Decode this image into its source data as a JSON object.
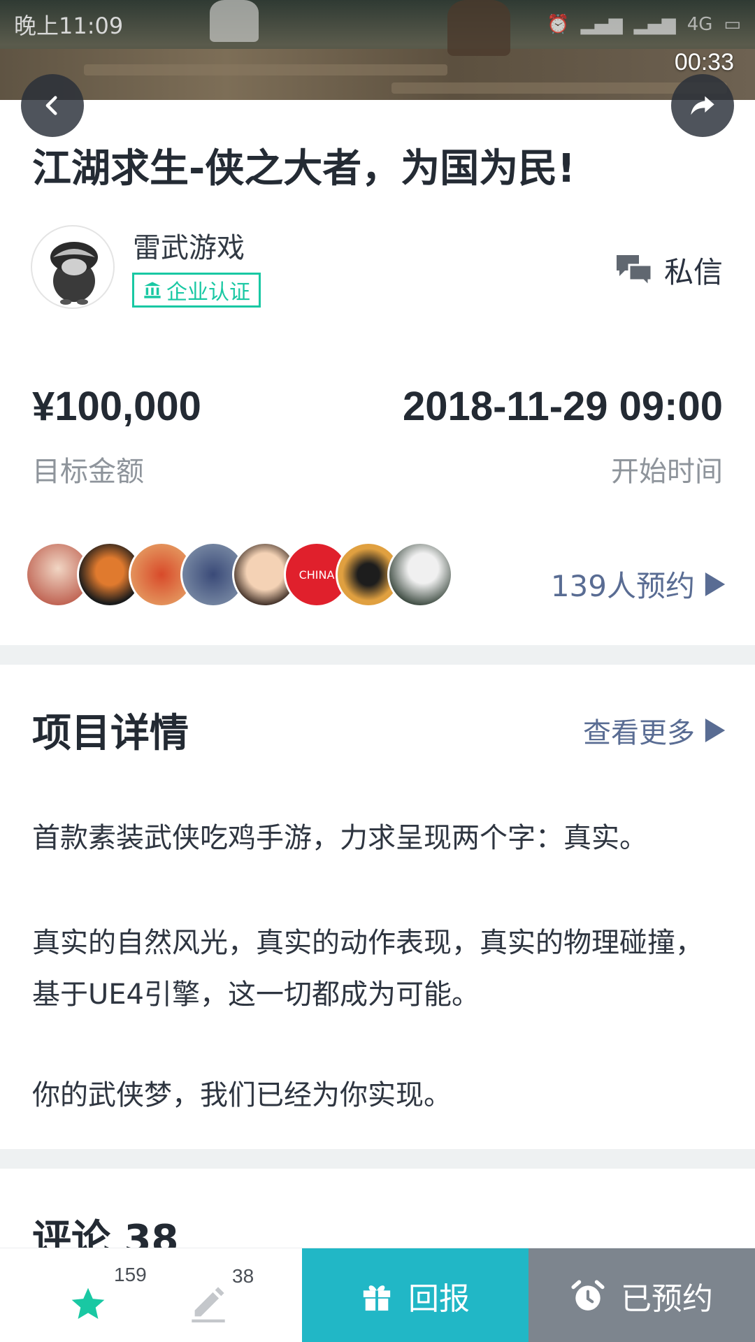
{
  "status_bar": {
    "time": "晚上11:09",
    "network": "4G"
  },
  "video": {
    "time": "00:33"
  },
  "project": {
    "title": "江湖求生-侠之大者，为国为民!",
    "author": "雷武游戏",
    "verified_label": "企业认证",
    "dm_label": "私信",
    "amount": "¥100,000",
    "amount_label": "目标金额",
    "start_time": "2018-11-29 09:00",
    "start_label": "开始时间",
    "reserve_count": "139人预约",
    "supporter_badge": "CHINA"
  },
  "details": {
    "title": "项目详情",
    "see_more": "查看更多",
    "paragraphs": [
      "首款素装武侠吃鸡手游，力求呈现两个字：真实。",
      "真实的自然风光，真实的动作表现，真实的物理碰撞，基于UE4引擎，这一切都成为可能。",
      "你的武侠梦，我们已经为你实现。"
    ]
  },
  "comments": {
    "title": "评论 38"
  },
  "bottom_bar": {
    "favorite_count": "159",
    "comment_count": "38",
    "reward_label": "回报",
    "reserved_label": "已预约"
  },
  "colors": {
    "accent_green": "#19c8a3",
    "reward_teal": "#21b7c6",
    "reserved_gray": "#7d858e",
    "link_blue": "#596c93"
  },
  "icons": [
    "back-icon",
    "share-icon",
    "bank-icon",
    "message-icon",
    "play-triangle-icon",
    "star-icon",
    "pencil-icon",
    "gift-icon",
    "alarm-clock-icon"
  ]
}
